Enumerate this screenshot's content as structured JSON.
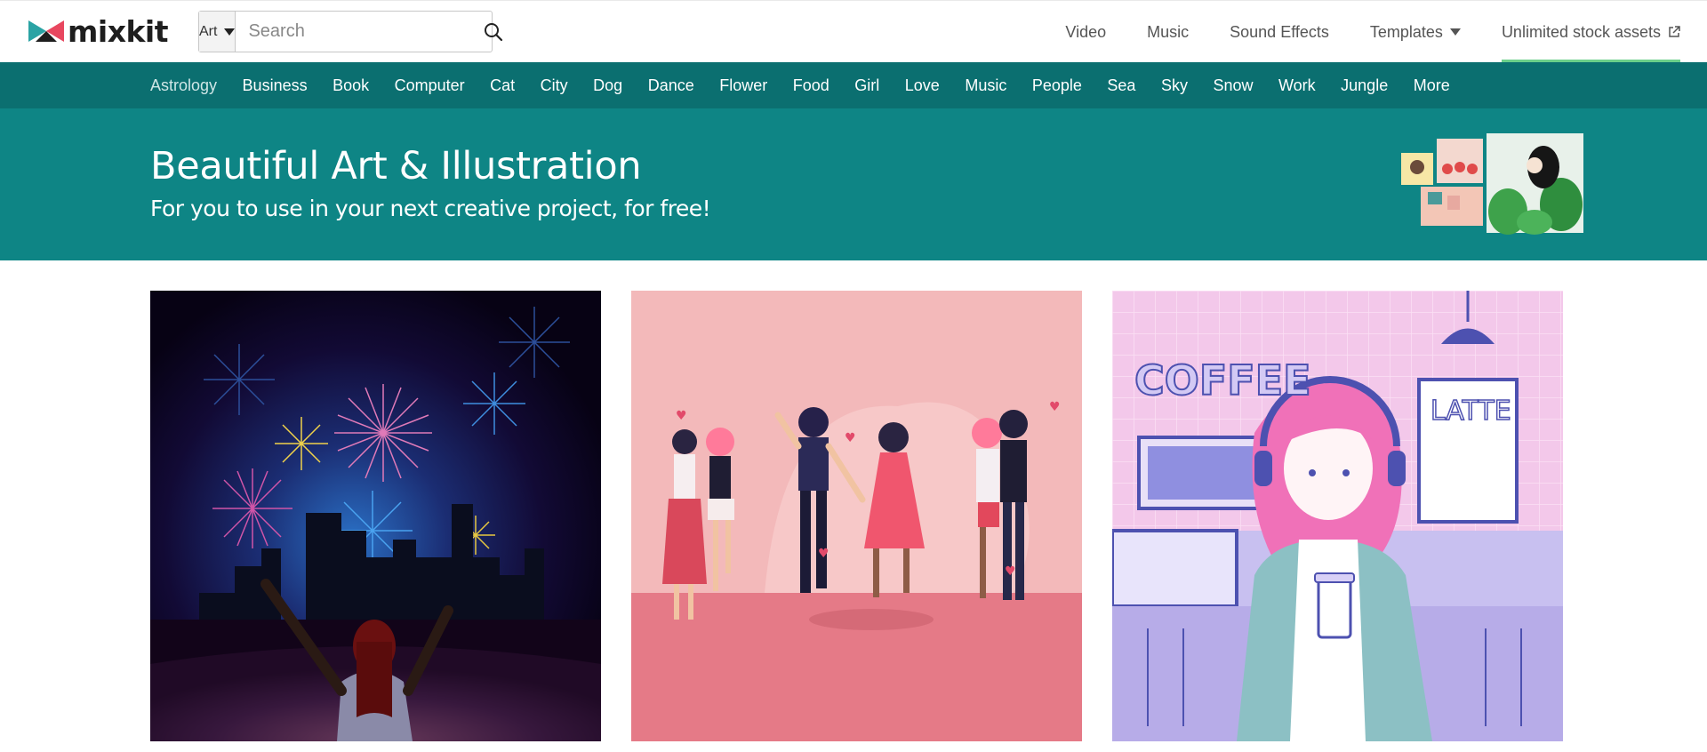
{
  "header": {
    "logo_text": "mixkit",
    "search": {
      "category": "Art",
      "placeholder": "Search"
    },
    "nav": [
      {
        "label": "Video"
      },
      {
        "label": "Music"
      },
      {
        "label": "Sound Effects"
      },
      {
        "label": "Templates"
      },
      {
        "label": "Unlimited stock assets"
      }
    ]
  },
  "categories": [
    "Astrology",
    "Business",
    "Book",
    "Computer",
    "Cat",
    "City",
    "Dog",
    "Dance",
    "Flower",
    "Food",
    "Girl",
    "Love",
    "Music",
    "People",
    "Sea",
    "Sky",
    "Snow",
    "Work",
    "Jungle",
    "More"
  ],
  "hero": {
    "title": "Beautiful Art & Illustration",
    "subtitle": "For you to use in your next creative project, for free!"
  },
  "cards": [
    {
      "icon": "fireworks-city-illustration"
    },
    {
      "icon": "dancing-couples-illustration"
    },
    {
      "icon": "coffee-shop-girl-illustration",
      "sign_text": "COFFEE",
      "menu_text": "LATTE"
    }
  ],
  "colors": {
    "nav_bar": "#0b6f70",
    "hero": "#0e8585",
    "accent_underline": "#6bd08a"
  }
}
